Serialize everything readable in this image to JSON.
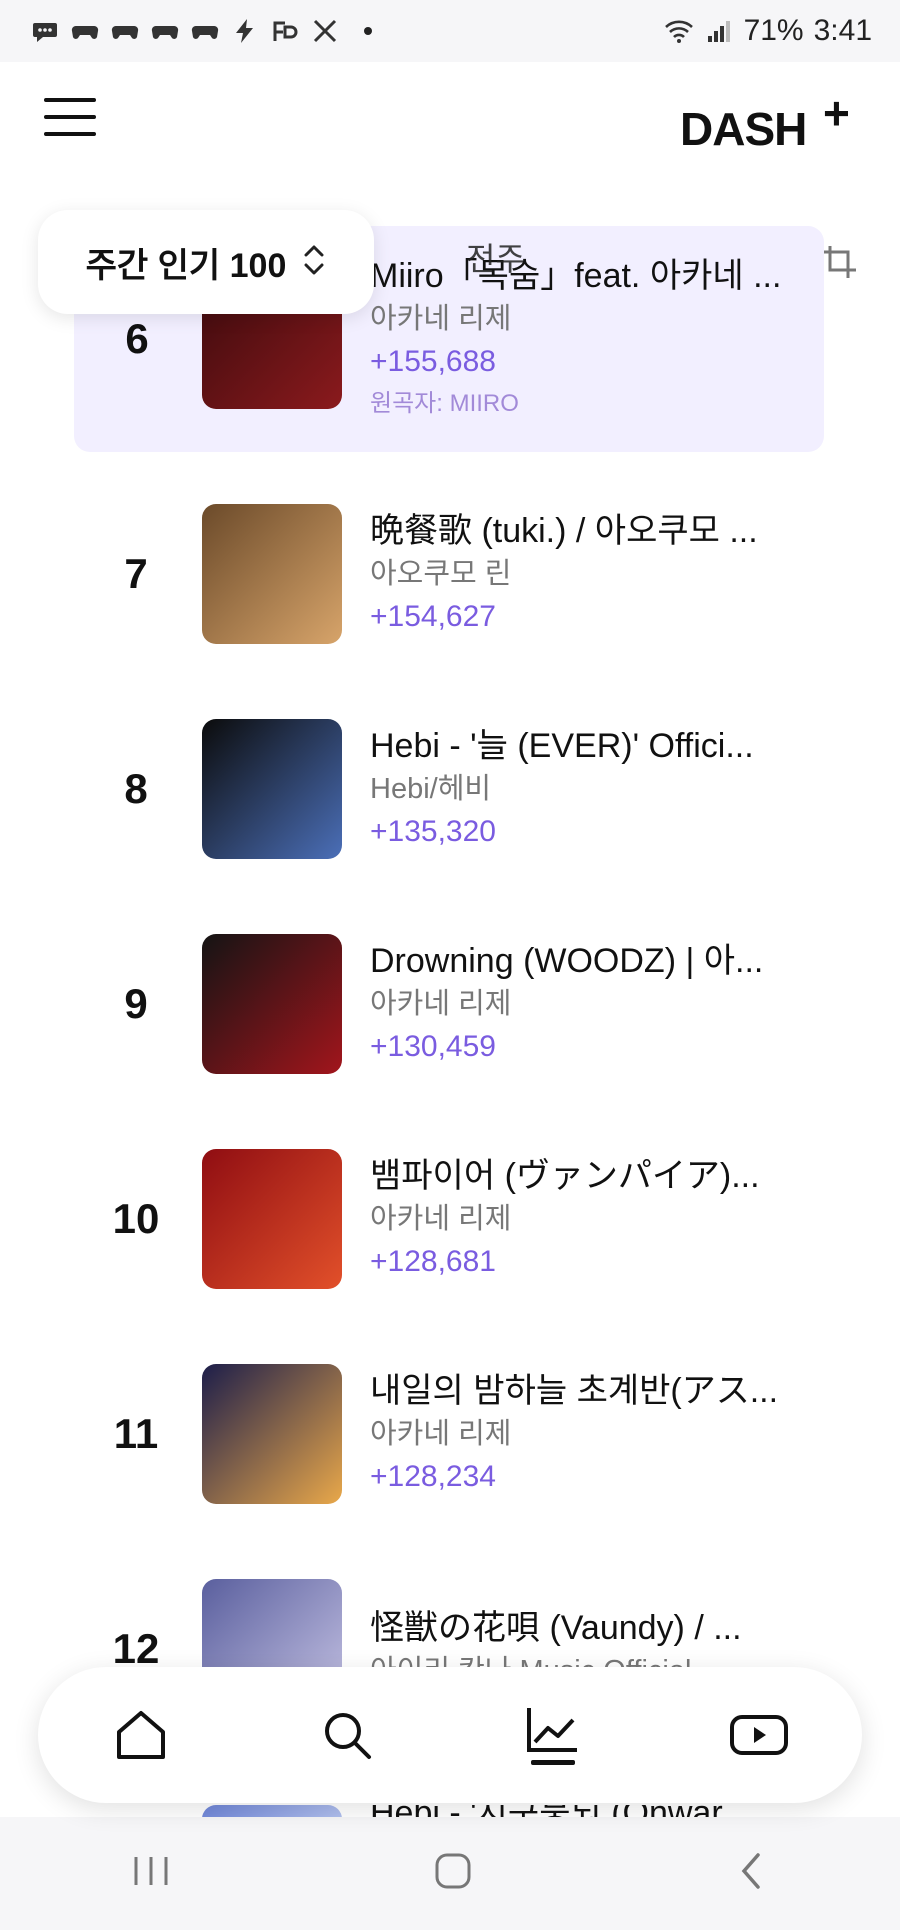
{
  "status_bar": {
    "icons": [
      "chat-icon",
      "game-controller-icon",
      "game-controller-icon",
      "game-controller-icon",
      "game-controller-icon",
      "bolt-icon",
      "app-icon",
      "x-icon"
    ],
    "battery": "71%",
    "time": "3:41"
  },
  "header": {
    "logo": "DASH",
    "logo_plus": "+"
  },
  "chart_selector": {
    "title": "주간 인기 100",
    "overlay_text": "전주"
  },
  "songs": [
    {
      "rank": "6",
      "title": "Miiro「목숨」feat. 아카네 ...",
      "artist": "아카네 리제",
      "delta": "+155,688",
      "original": "원곡자: MIIRO",
      "thumb_colors": [
        "#3a0a0d",
        "#8b1a1d"
      ]
    },
    {
      "rank": "7",
      "title": "晩餐歌 (tuki.) / 아오쿠모 ...",
      "artist": "아오쿠모 린",
      "delta": "+154,627",
      "thumb_colors": [
        "#6b4a2a",
        "#d7a46a"
      ]
    },
    {
      "rank": "8",
      "title": "Hebi - '늘 (EVER)' Offici...",
      "artist": "Hebi/헤비",
      "delta": "+135,320",
      "thumb_colors": [
        "#0b0b0b",
        "#4b6fb8"
      ]
    },
    {
      "rank": "9",
      "title": "Drowning (WOODZ) | 아...",
      "artist": "아카네 리제",
      "delta": "+130,459",
      "thumb_colors": [
        "#141414",
        "#a2151c"
      ]
    },
    {
      "rank": "10",
      "title": "뱀파이어 (ヴァンパイア)...",
      "artist": "아카네 리제",
      "delta": "+128,681",
      "thumb_colors": [
        "#8f0d12",
        "#e2502a"
      ]
    },
    {
      "rank": "11",
      "title": "내일의 밤하늘 초계반(アス...",
      "artist": "아카네 리제",
      "delta": "+128,234",
      "thumb_colors": [
        "#1c1d4a",
        "#e9a84a"
      ]
    },
    {
      "rank": "12",
      "title": "怪獣の花唄 (Vaundy) / ...",
      "artist": "아이리 칸나 Music Official",
      "delta": "",
      "thumb_colors": [
        "#5a5f9e",
        "#c9c6e6"
      ]
    }
  ],
  "peek_row": {
    "title": "Hebi - '지구붕되 (Onwar...",
    "thumb_colors": [
      "#6f86d8",
      "#b8c6f1"
    ]
  },
  "bottom_nav": {
    "items": [
      "home-icon",
      "search-icon",
      "chart-icon",
      "youtube-icon"
    ]
  }
}
